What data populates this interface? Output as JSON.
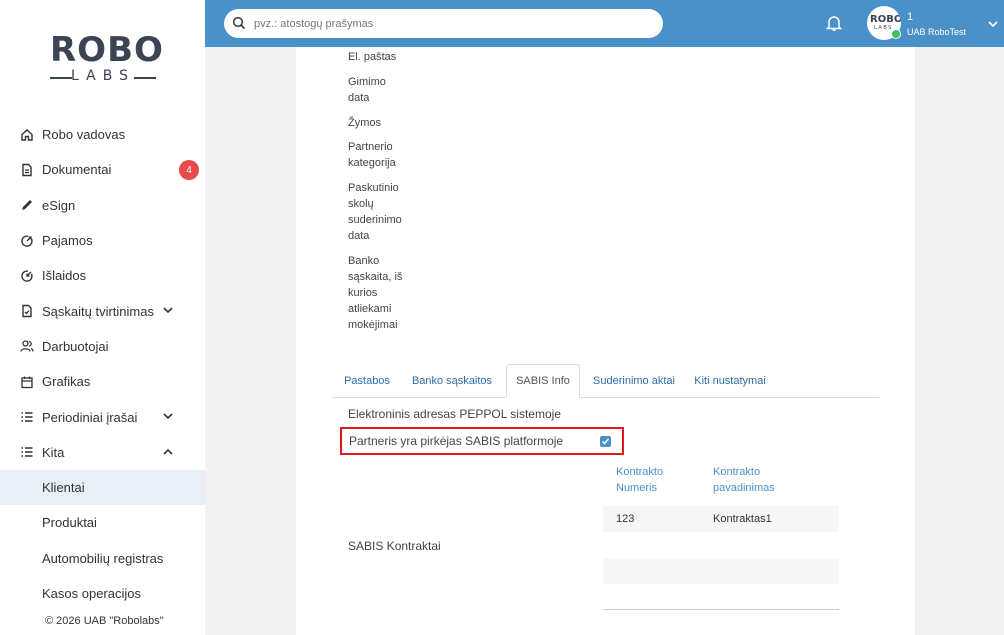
{
  "sidebar": {
    "logo_top": "ROBO",
    "logo_bottom": "LABS",
    "items": [
      {
        "label": "Robo vadovas",
        "icon": "home-icon"
      },
      {
        "label": "Dokumentai",
        "icon": "document-icon",
        "badge": "4"
      },
      {
        "label": "eSign",
        "icon": "pen-icon"
      },
      {
        "label": "Pajamos",
        "icon": "income-icon"
      },
      {
        "label": "Išlaidos",
        "icon": "expense-icon"
      },
      {
        "label": "Sąskaitų tvirtinimas",
        "icon": "invoice-check-icon",
        "chevron": "down"
      },
      {
        "label": "Darbuotojai",
        "icon": "users-icon"
      },
      {
        "label": "Grafikas",
        "icon": "calendar-icon"
      },
      {
        "label": "Periodiniai įrašai",
        "icon": "list-icon",
        "chevron": "down"
      },
      {
        "label": "Kita",
        "icon": "list-icon",
        "chevron": "up"
      },
      {
        "label": "Klientai",
        "sub": true,
        "active": true
      },
      {
        "label": "Produktai",
        "sub": true
      },
      {
        "label": "Automobilių registras",
        "sub": true
      },
      {
        "label": "Kasos operacijos",
        "sub": true
      }
    ],
    "copyright": "© 2026 UAB \"Robolabs\""
  },
  "header": {
    "search_placeholder": "pvz.: atostogų prašymas",
    "user_number": "1",
    "company": "UAB RoboTest",
    "status_color": "#3cc35c"
  },
  "form": {
    "fields": [
      "El. paštas",
      "Gimimo data",
      "Žymos",
      "Partnerio kategorija",
      "Paskutinio skolų suderinimo data",
      "Banko sąskaita, iš kurios atliekami mokėjimai"
    ]
  },
  "tabs": [
    {
      "label": "Pastabos",
      "active": false
    },
    {
      "label": "Banko sąskaitos",
      "active": false
    },
    {
      "label": "SABIS Info",
      "active": true
    },
    {
      "label": "Suderinimo aktai",
      "active": false
    },
    {
      "label": "Kiti nustatymai",
      "active": false
    }
  ],
  "sabis": {
    "peppol_label": "Elektroninis adresas PEPPOL sistemoje",
    "buyer_label": "Partneris yra pirkėjas SABIS platformoje",
    "buyer_checked": true,
    "contracts_label": "SABIS Kontraktai",
    "table": {
      "headers": [
        "Kontrakto Numeris",
        "Kontrakto pavadinimas"
      ],
      "rows": [
        [
          "123",
          "Kontraktas1"
        ]
      ]
    }
  },
  "colors": {
    "accent": "#4a90c9",
    "highlight_border": "#e0191f",
    "badge": "#e84a4a"
  }
}
